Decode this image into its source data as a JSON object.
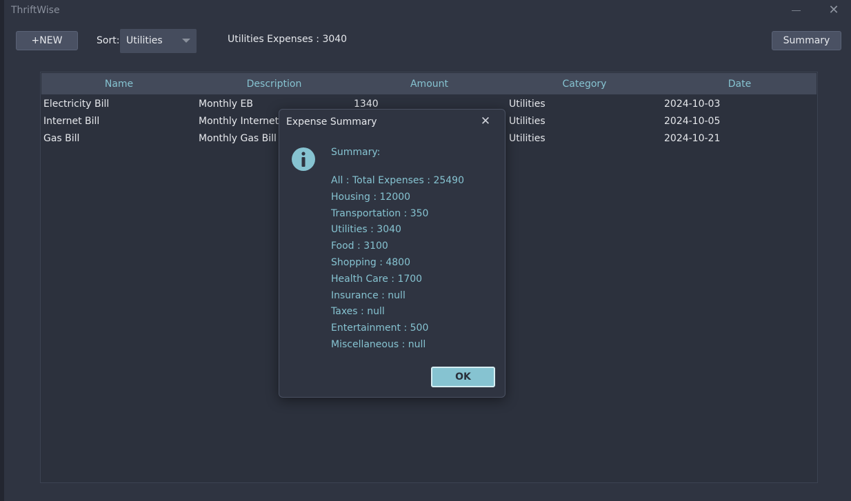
{
  "app": {
    "title": "ThriftWise"
  },
  "toolbar": {
    "new_label": "+NEW",
    "sort_label": "Sort:",
    "sort_value": "Utilities",
    "expense_total": "Utilities Expenses : 3040",
    "summary_label": "Summary"
  },
  "table": {
    "columns": [
      "Name",
      "Description",
      "Amount",
      "Category",
      "Date"
    ],
    "rows": [
      [
        "Electricity Bill",
        "Monthly EB",
        "1340",
        "Utilities",
        "2024-10-03"
      ],
      [
        "Internet Bill",
        "Monthly Internet Bill",
        "",
        "Utilities",
        "2024-10-05"
      ],
      [
        "Gas Bill",
        "Monthly Gas Bill",
        "",
        "Utilities",
        "2024-10-21"
      ]
    ]
  },
  "dialog": {
    "title": "Expense Summary",
    "heading": "Summary:",
    "lines": [
      "All : Total Expenses : 25490",
      "Housing : 12000",
      "Transportation : 350",
      "Utilities : 3040",
      "Food : 3100",
      "Shopping : 4800",
      "Health Care : 1700",
      "Insurance : null",
      "Taxes : null",
      "Entertainment : 500",
      "Miscellaneous : null"
    ],
    "ok_label": "OK"
  },
  "colors": {
    "accent": "#86c3d1",
    "background": "#2f3441",
    "button": "#4a5163"
  },
  "icons": {
    "info": "info-circle-icon",
    "close": "close-icon",
    "minimize": "minimize-icon",
    "dropdown": "chevron-down-icon"
  }
}
